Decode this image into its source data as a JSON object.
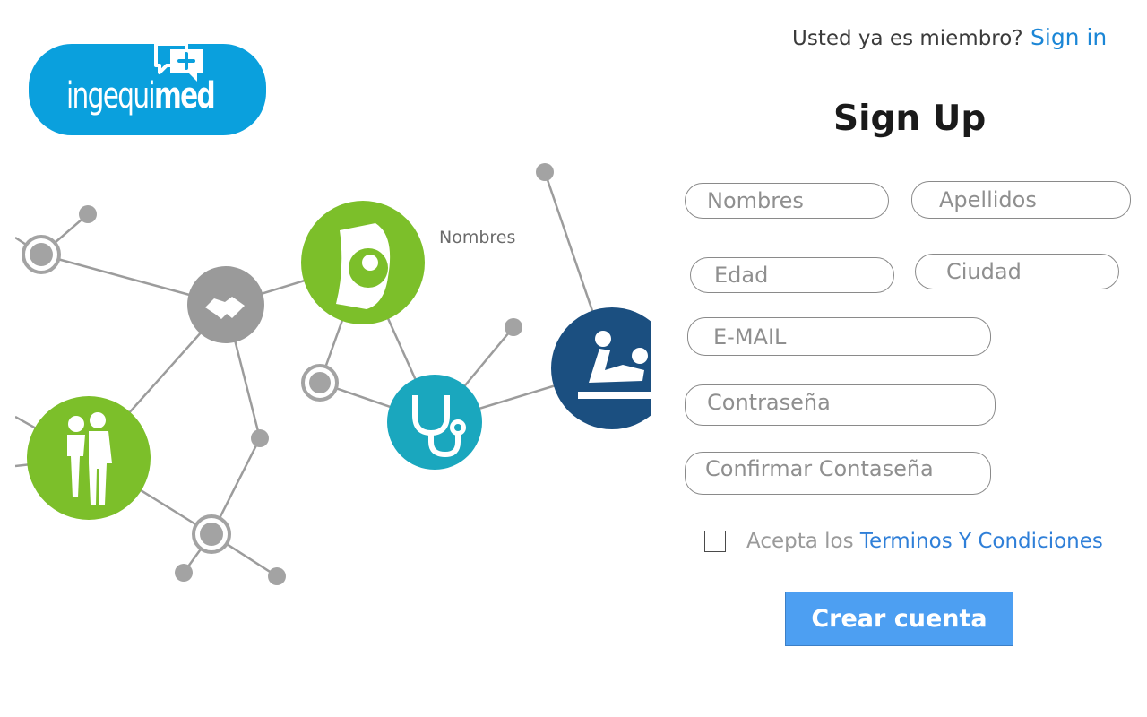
{
  "logo": {
    "text_light": "ingequi",
    "text_bold": "med"
  },
  "header": {
    "member_question": "Usted ya es miembro?",
    "signin_label": "Sign in"
  },
  "illustration": {
    "caption": "Nombres"
  },
  "form": {
    "title": "Sign Up",
    "nombres_placeholder": "Nombres",
    "apellidos_placeholder": "Apellidos",
    "edad_placeholder": "Edad",
    "ciudad_placeholder": "Ciudad",
    "email_placeholder": "E-MAIL",
    "password_placeholder": "Contraseña",
    "confirm_placeholder": "Confirmar Contaseña",
    "terms_prefix": "Acepta los ",
    "terms_link": "Terminos Y Condiciones",
    "submit_label": "Crear cuenta"
  },
  "colors": {
    "brand": "#0aa0dd",
    "link": "#1b86d6",
    "button": "#4d9ff2",
    "node_green": "#7cbf2a",
    "node_teal": "#1aa7be",
    "node_navy": "#1b4f80",
    "node_gray": "#9a9a9a"
  },
  "icons": [
    "chat-plus-icon",
    "pregnancy-icon",
    "handshake-icon",
    "stethoscope-icon",
    "family-icon",
    "physiotherapy-icon"
  ]
}
